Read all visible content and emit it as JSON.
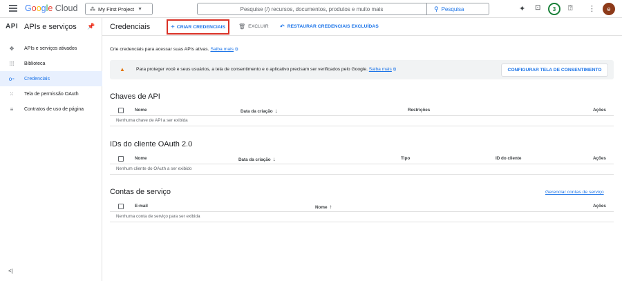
{
  "topbar": {
    "logo_parts": [
      "G",
      "o",
      "o",
      "g",
      "l",
      "e",
      " Cloud"
    ],
    "project": "My First Project",
    "search_placeholder": "Pesquise (/) recursos, documentos, produtos e muito mais",
    "search_button": "Pesquisa",
    "notifications_count": "3",
    "avatar_letter": "e"
  },
  "sidebar": {
    "logo": "API",
    "title": "APIs e serviços",
    "items": [
      {
        "label": "APIs e serviços ativados",
        "icon": "✥"
      },
      {
        "label": "Biblioteca",
        "icon": "⁞⁞⁞"
      },
      {
        "label": "Credenciais",
        "icon": "o⁃"
      },
      {
        "label": "Tela de permissão OAuth",
        "icon": "⁙"
      },
      {
        "label": "Contratos de uso de página",
        "icon": "≡"
      }
    ],
    "active_index": 2,
    "collapse_label": "<|"
  },
  "actions": {
    "title": "Credenciais",
    "create": "CRIAR CREDENCIAIS",
    "delete": "EXCLUIR",
    "restore": "RESTAURAR CREDENCIAIS EXCLUÍDAS"
  },
  "intro": {
    "text": "Crie credenciais para acessar suas APIs ativas.",
    "link": "Saiba mais"
  },
  "banner": {
    "text": "Para proteger você e seus usuários, a tela de consentimento e o aplicativo precisam ser verificados pelo Google.",
    "link": "Saiba mais",
    "button": "CONFIGURAR TELA DE CONSENTIMENTO"
  },
  "api_keys": {
    "title": "Chaves de API",
    "columns": [
      "Nome",
      "Data da criação",
      "Restrições",
      "Ações"
    ],
    "empty": "Nenhuma chave de API a ser exibida"
  },
  "oauth": {
    "title": "IDs do cliente OAuth 2.0",
    "columns": [
      "Nome",
      "Data da criação",
      "Tipo",
      "ID do cliente",
      "Ações"
    ],
    "empty": "Nenhum cliente do OAuth a ser exibido"
  },
  "service_accounts": {
    "title": "Contas de serviço",
    "manage_link": "Gerenciar contas de serviço",
    "columns": [
      "E-mail",
      "Nome",
      "Ações"
    ],
    "empty": "Nenhuma conta de serviço para ser exibida"
  },
  "colors": {
    "accent": "#1a73e8",
    "highlight_box": "#d93025",
    "warning": "#e37400",
    "badge": "#188038",
    "avatar": "#8d3a19"
  }
}
